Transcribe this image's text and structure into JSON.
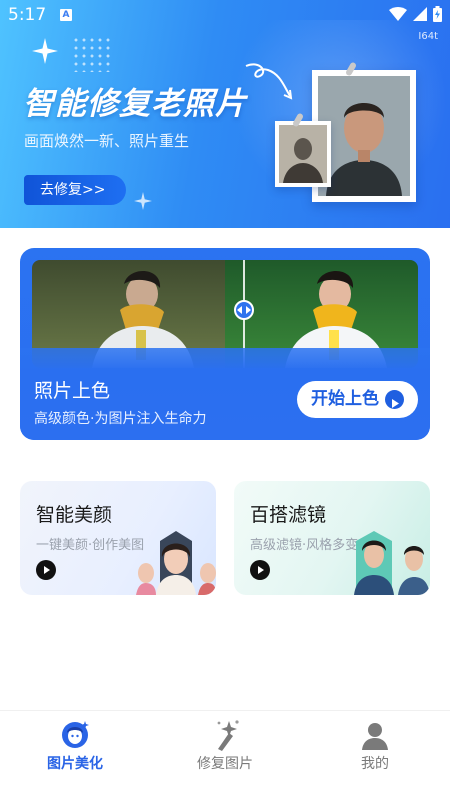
{
  "status_bar": {
    "time": "5:17",
    "notification_badge": "A"
  },
  "banner": {
    "tag": "I64t",
    "title": "智能修复老照片",
    "subtitle": "画面焕然一新、照片重生",
    "button_label": "去修复>>"
  },
  "colorize_card": {
    "title": "照片上色",
    "subtitle": "高级颜色·为图片注入生命力",
    "button_label": "开始上色"
  },
  "features": [
    {
      "title": "智能美颜",
      "subtitle": "一键美颜·创作美图"
    },
    {
      "title": "百搭滤镜",
      "subtitle": "高级滤镜·风格多变"
    }
  ],
  "nav": {
    "items": [
      {
        "label": "图片美化",
        "icon": "portrait-beautify-icon",
        "active": true
      },
      {
        "label": "修复图片",
        "icon": "magic-wand-icon",
        "active": false
      },
      {
        "label": "我的",
        "icon": "user-icon",
        "active": false
      }
    ]
  },
  "colors": {
    "primary": "#2f6ff0",
    "nav_active": "#2a64e6",
    "nav_inactive": "#7a7a7a"
  }
}
